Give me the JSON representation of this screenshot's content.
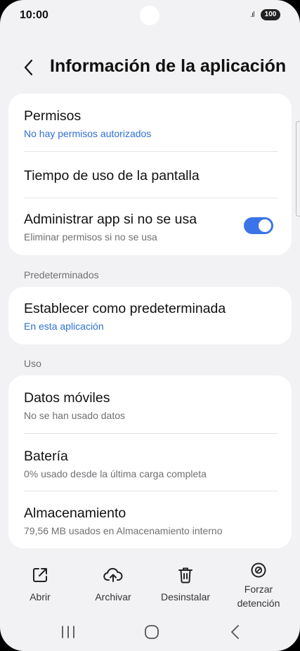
{
  "status_bar": {
    "time": "10:00",
    "signal": ".ıl",
    "battery": "100"
  },
  "header": {
    "back_icon": "chevron-left-icon",
    "title": "Información de la aplicación"
  },
  "card1": {
    "permissions": {
      "title": "Permisos",
      "subtitle": "No hay permisos autorizados"
    },
    "screen_time": {
      "title": "Tiempo de uso de la pantalla"
    },
    "manage_unused": {
      "title": "Administrar app si no se usa",
      "subtitle": "Eliminar permisos si no se usa",
      "toggle_on": true
    }
  },
  "defaults": {
    "section_label": "Predeterminados",
    "set_default": {
      "title": "Establecer como predeterminada",
      "subtitle": "En esta aplicación"
    }
  },
  "usage": {
    "section_label": "Uso",
    "mobile_data": {
      "title": "Datos móviles",
      "subtitle": "No se han usado datos"
    },
    "battery": {
      "title": "Batería",
      "subtitle": "0% usado desde la última carga completa"
    },
    "storage": {
      "title": "Almacenamiento",
      "subtitle": "79,56 MB usados en Almacenamiento interno"
    }
  },
  "actions": {
    "open": {
      "label": "Abrir",
      "icon": "open-external-icon"
    },
    "archive": {
      "label": "Archivar",
      "icon": "cloud-upload-icon"
    },
    "uninstall": {
      "label": "Desinstalar",
      "icon": "trash-icon"
    },
    "force_stop_line1": "Forzar",
    "force_stop_line2": "detención",
    "force_stop_icon": "block-icon"
  },
  "navigation": {
    "recents_icon": "recents-icon",
    "home_icon": "home-icon",
    "back_icon": "back-icon"
  },
  "colors": {
    "accent": "#3b74e8",
    "link_text": "#2f6fd6",
    "background": "#f2f2f4",
    "card": "#ffffff"
  }
}
